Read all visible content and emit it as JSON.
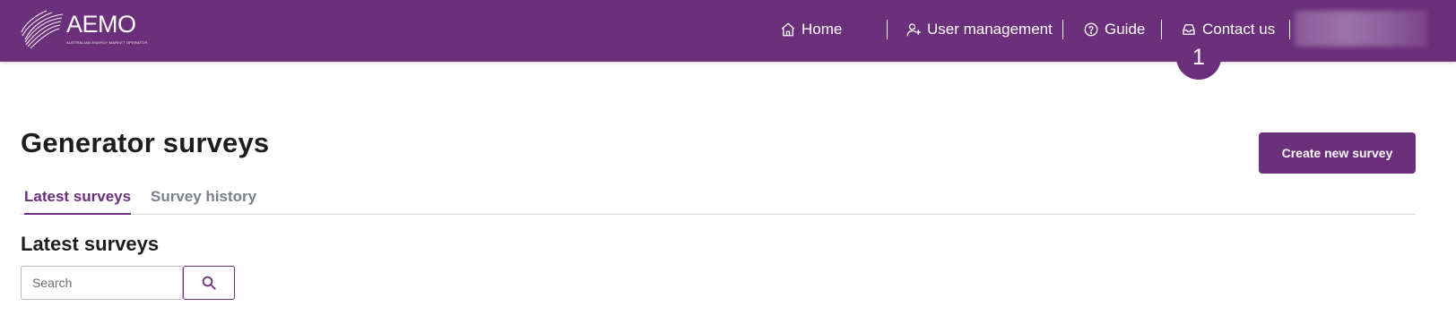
{
  "header": {
    "logo": {
      "wordmark": "AEMO",
      "tagline": "AUSTRALIAN ENERGY MARKET OPERATOR"
    },
    "nav": [
      {
        "label": "Home",
        "icon": "home-icon"
      },
      {
        "label": "User management",
        "icon": "user-plus-icon"
      },
      {
        "label": "Guide",
        "icon": "help-circle-icon"
      },
      {
        "label": "Contact us",
        "icon": "inbox-icon"
      }
    ],
    "callout_badge": "1",
    "colors": {
      "brand": "#6b2f7b",
      "text_on_brand": "#ffffff"
    }
  },
  "main": {
    "title": "Generator surveys",
    "create_button": "Create new survey",
    "tabs": [
      {
        "label": "Latest surveys",
        "active": true
      },
      {
        "label": "Survey history",
        "active": false
      }
    ],
    "section_title": "Latest surveys",
    "search": {
      "placeholder": "Search",
      "value": "",
      "button_icon": "search-icon"
    }
  }
}
